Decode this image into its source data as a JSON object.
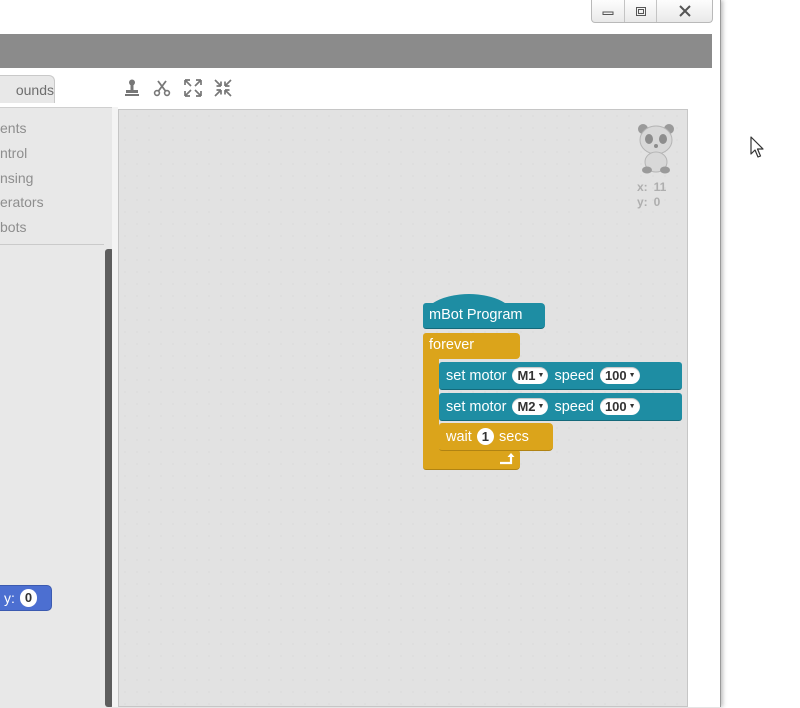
{
  "window": {
    "controls": [
      {
        "name": "minimize",
        "icon": "minimize-icon"
      },
      {
        "name": "restore",
        "icon": "restore-icon"
      },
      {
        "name": "close",
        "icon": "close-icon"
      }
    ]
  },
  "tabs": {
    "sounds_label": "ounds"
  },
  "toolbar": {
    "tools": [
      "duplicate-stamp-icon",
      "delete-scissors-icon",
      "grow-icon",
      "shrink-icon"
    ]
  },
  "palette": {
    "categories": [
      "ents",
      "ntrol",
      "nsing",
      "erators",
      "bots"
    ],
    "goto_block": {
      "label": "y:",
      "value": "0"
    }
  },
  "stage": {
    "sprite_icon": "panda-sprite-icon",
    "coords": {
      "x_label": "x:",
      "x_value": "11",
      "y_label": "y:",
      "y_value": "0"
    }
  },
  "script": {
    "hat": {
      "label": "mBot Program"
    },
    "forever": {
      "label": "forever"
    },
    "motor_blocks": [
      {
        "label": "set motor",
        "port": "M1",
        "speed_label": "speed",
        "speed": "100"
      },
      {
        "label": "set motor",
        "port": "M2",
        "speed_label": "speed",
        "speed": "100"
      }
    ],
    "wait": {
      "label": "wait",
      "value": "1",
      "unit": "secs"
    }
  },
  "colors": {
    "mbot_block": "#1e8da3",
    "control_block": "#dba41b",
    "motion_block": "#4c6fd1",
    "stage_bg": "#e2e2e2",
    "menubar": "#8b8b8b"
  }
}
